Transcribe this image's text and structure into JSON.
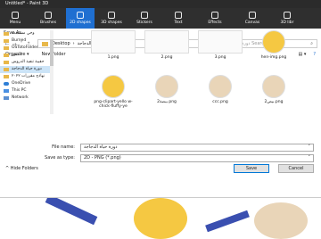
{
  "window": {
    "title": "Untitled* - Paint 3D"
  },
  "toolbar": [
    {
      "label": "Menu"
    },
    {
      "label": "Brushes"
    },
    {
      "label": "2D shapes",
      "active": true
    },
    {
      "label": "3D shapes"
    },
    {
      "label": "Stickers"
    },
    {
      "label": "Text"
    },
    {
      "label": "Effects"
    },
    {
      "label": "Canvas"
    },
    {
      "label": "3D libr"
    }
  ],
  "dialog": {
    "title": "Save As",
    "address": {
      "root": "Desktop",
      "sep": "›",
      "folder": "دورة حياة الدجاجة"
    },
    "search_placeholder": "Search دورة حياة الدجاجة",
    "organize": "Organize ▾",
    "new_folder": "New folder",
    "sidebar": [
      {
        "label": "وحي مستجدة",
        "type": "folder"
      },
      {
        "label": "Burned",
        "type": "folder"
      },
      {
        "label": "OSTotoFolder",
        "type": "folder"
      },
      {
        "label": "الصور",
        "type": "folder"
      },
      {
        "label": "حقيبة تنفيذ الدروس",
        "type": "folder"
      },
      {
        "label": "دورة حياة الدجاجة",
        "type": "folder",
        "selected": true
      },
      {
        "label": "نهاذج مقررات ٢٠٢٢",
        "type": "folder"
      },
      {
        "label": "OneDrive",
        "type": "cloud"
      },
      {
        "label": "This PC",
        "type": "pc"
      },
      {
        "label": "Network",
        "type": "net"
      }
    ],
    "files": [
      {
        "name": "1.png"
      },
      {
        "name": "2.png"
      },
      {
        "name": "3.png"
      },
      {
        "name": "hen-img.png"
      },
      {
        "name": "png-clipart-yello w-chick-fluffy-ye"
      },
      {
        "name": "بيضة2.png"
      },
      {
        "name": "ccc.png"
      },
      {
        "name": "بيض2.png"
      }
    ],
    "file_name_label": "File name:",
    "file_name_value": "دورة حياة الدجاجة",
    "save_type_label": "Save as type:",
    "save_type_value": "2D - PNG (*.png)",
    "hide_folders": "Hide Folders",
    "save_label": "Save",
    "cancel_label": "Cancel"
  }
}
